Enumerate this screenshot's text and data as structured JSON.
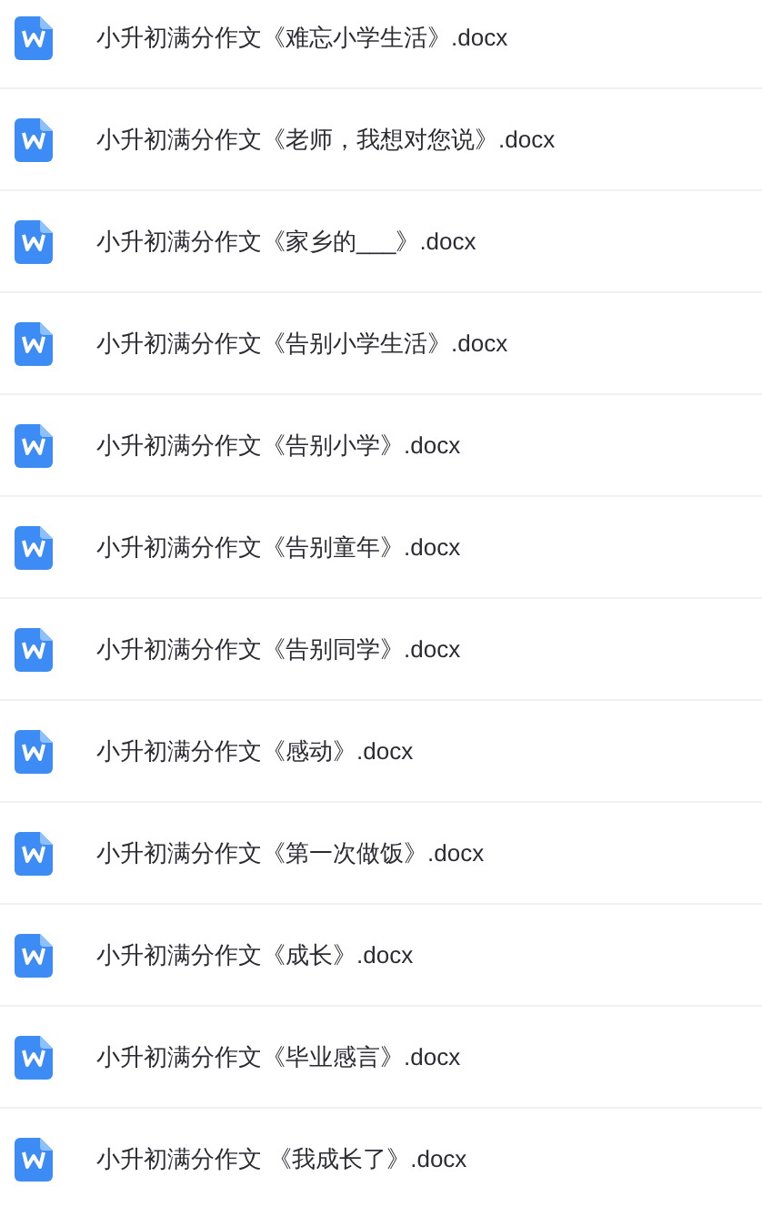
{
  "files": [
    {
      "name": "小升初满分作文《难忘小学生活》.docx"
    },
    {
      "name": "小升初满分作文《老师，我想对您说》.docx"
    },
    {
      "name": "小升初满分作文《家乡的___》.docx"
    },
    {
      "name": "小升初满分作文《告别小学生活》.docx"
    },
    {
      "name": "小升初满分作文《告别小学》.docx"
    },
    {
      "name": "小升初满分作文《告别童年》.docx"
    },
    {
      "name": "小升初满分作文《告别同学》.docx"
    },
    {
      "name": "小升初满分作文《感动》.docx"
    },
    {
      "name": "小升初满分作文《第一次做饭》.docx"
    },
    {
      "name": "小升初满分作文《成长》.docx"
    },
    {
      "name": "小升初满分作文《毕业感言》.docx"
    },
    {
      "name": "小升初满分作文 《我成长了》.docx"
    }
  ]
}
